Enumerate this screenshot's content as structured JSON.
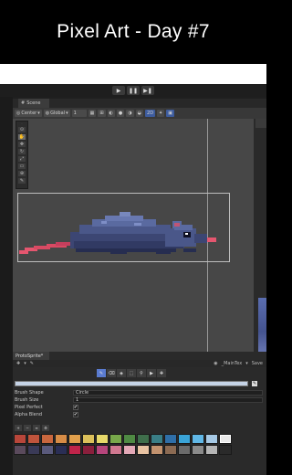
{
  "video_title": "Pixel Art - Day #7",
  "scene_tab": {
    "label": "Scene"
  },
  "toolbar": {
    "pivot": "Center",
    "space": "Global",
    "grid_snap": "1",
    "mode_2d": "2D"
  },
  "playback": {
    "play": "▶",
    "pause": "❚❚",
    "step": "▶❚"
  },
  "sprite_panel": {
    "tab_label": "ProtoSprite*",
    "texture_field": "_MainTex",
    "save_label": "Save",
    "properties": [
      {
        "label": "Brush Shape",
        "value": "Circle"
      },
      {
        "label": "Brush Size",
        "value": "1"
      },
      {
        "label": "Pixel Perfect",
        "value": "✔"
      },
      {
        "label": "Alpha Blend",
        "value": "✔"
      }
    ],
    "current_color": "#c5d3e6"
  },
  "palette": [
    "#b8463a",
    "#c0543c",
    "#c9673e",
    "#d78c46",
    "#e1a04c",
    "#dcc05a",
    "#e7d96a",
    "#78a84a",
    "#4f8a43",
    "#3f6e4b",
    "#3a7e86",
    "#2f6fa8",
    "#3aa4d8",
    "#60b7e6",
    "#a6c9e5",
    "#e9e9e9",
    "#5a4a5c",
    "#3a3a57",
    "#5a5a7c",
    "#2a2e55",
    "#c0244a",
    "#8a1f3c",
    "#b6457c",
    "#d07890",
    "#e4a9b7",
    "#e9c3a3",
    "#c3936f",
    "#8c6b53",
    "#6b6b6b",
    "#8a8a8a",
    "#b5b5b5",
    "#2a2a2a"
  ],
  "selected_swatch_index": 15
}
